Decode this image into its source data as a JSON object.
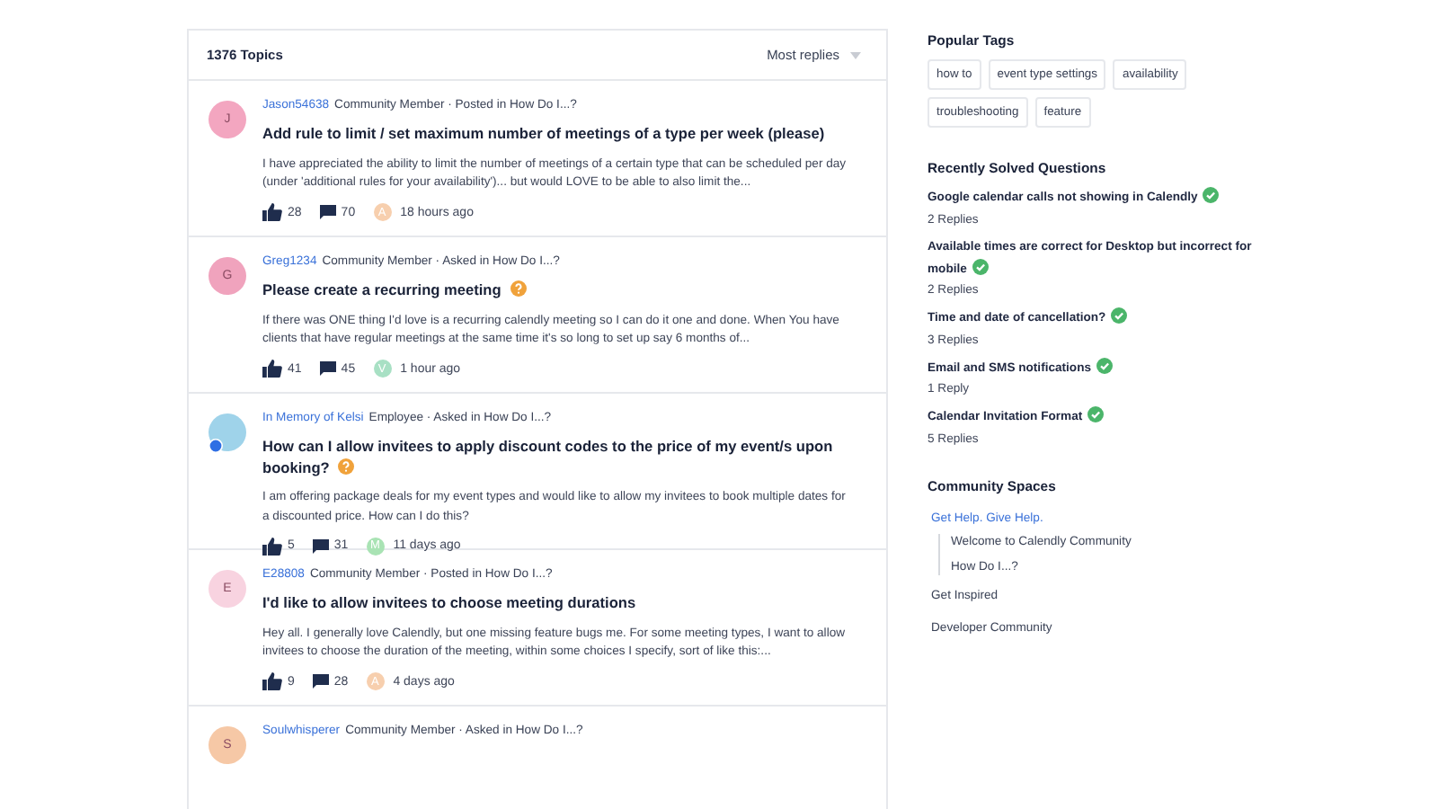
{
  "topics_header": {
    "count": "1376 Topics",
    "sort": "Most replies"
  },
  "topics": [
    {
      "avatar": {
        "kind": "letter",
        "letter": "J",
        "color": "#f3a6c0"
      },
      "author": "Jason54638",
      "info": "Community Member · Posted in How Do I...?",
      "title": "Add rule to limit / set maximum number of meetings of a type per week (please)",
      "unanswered": false,
      "excerpt": "I have appreciated the ability to limit the number of meetings of a certain type that can be scheduled per day (under 'additional rules for your availability')... but would LOVE to be able to also limit the...",
      "likes": "28",
      "comments": "70",
      "last": {
        "letter": "A",
        "color": "#f7cfae"
      },
      "time": "18 hours ago"
    },
    {
      "avatar": {
        "kind": "letter",
        "letter": "G",
        "color": "#f0a3bd"
      },
      "author": "Greg1234",
      "info": "Community Member · Asked in How Do I...?",
      "title": "Please create a recurring meeting",
      "unanswered": true,
      "excerpt": "If there was ONE thing I'd love is a recurring calendly meeting so I can do it one and done. When You have clients that have regular meetings at the same time it's so long to set up say 6 months of...",
      "likes": "41",
      "comments": "45",
      "last": {
        "letter": "V",
        "color": "#a8e0c4"
      },
      "time": "1 hour ago"
    },
    {
      "avatar": {
        "kind": "photo",
        "color": "#9fd3ea"
      },
      "author": "In Memory of Kelsi",
      "info": "Employee · Asked in How Do I...?",
      "title": "How can I allow invitees to apply discount codes to the price of my event/s upon booking?",
      "unanswered": true,
      "excerpt": "I am offering package deals for my event types and would like to allow my invitees to book multiple dates for a discounted price. How can I do this?",
      "likes": "5",
      "comments": "31",
      "last": {
        "letter": "M",
        "color": "#a9e3b4"
      },
      "time": "11 days ago"
    },
    {
      "avatar": {
        "kind": "letter",
        "letter": "E",
        "color": "#f8d3e0"
      },
      "author": "E28808",
      "info": "Community Member · Posted in How Do I...?",
      "title": "I'd like to allow invitees to choose meeting durations",
      "unanswered": false,
      "excerpt": "Hey all. I generally love Calendly, but one missing feature bugs me. For some meeting types, I want to allow invitees to choose the duration of the meeting, within some choices I specify, sort of like this:...",
      "likes": "9",
      "comments": "28",
      "last": {
        "letter": "A",
        "color": "#f7cfae"
      },
      "time": "4 days ago"
    },
    {
      "avatar": {
        "kind": "letter",
        "letter": "S",
        "color": "#f6c8a6"
      },
      "author": "Soulwhisperer",
      "info": "Community Member · Asked in How Do I...?"
    }
  ],
  "sidebar": {
    "tags_title": "Popular Tags",
    "tags": [
      "how to",
      "event type settings",
      "availability",
      "troubleshooting",
      "feature"
    ],
    "solved_title": "Recently Solved Questions",
    "solved": [
      {
        "title": "Google calendar calls not showing in Calendly",
        "replies": "2 Replies"
      },
      {
        "title": "Available times are correct for Desktop but incorrect for mobile",
        "replies": "2 Replies"
      },
      {
        "title": "Time and date of cancellation?",
        "replies": "3 Replies"
      },
      {
        "title": "Email and SMS notifications",
        "replies": "1 Reply"
      },
      {
        "title": "Calendar Invitation Format",
        "replies": "5 Replies"
      }
    ],
    "spaces_title": "Community Spaces",
    "spaces": [
      {
        "label": "Get Help. Give Help.",
        "selected": true,
        "children": [
          {
            "label": "Welcome to Calendly Community",
            "selected": false
          },
          {
            "label": "How Do I...?",
            "selected": false
          }
        ]
      },
      {
        "label": "Get Inspired",
        "selected": false
      },
      {
        "label": "Developer Community",
        "selected": false
      }
    ]
  }
}
